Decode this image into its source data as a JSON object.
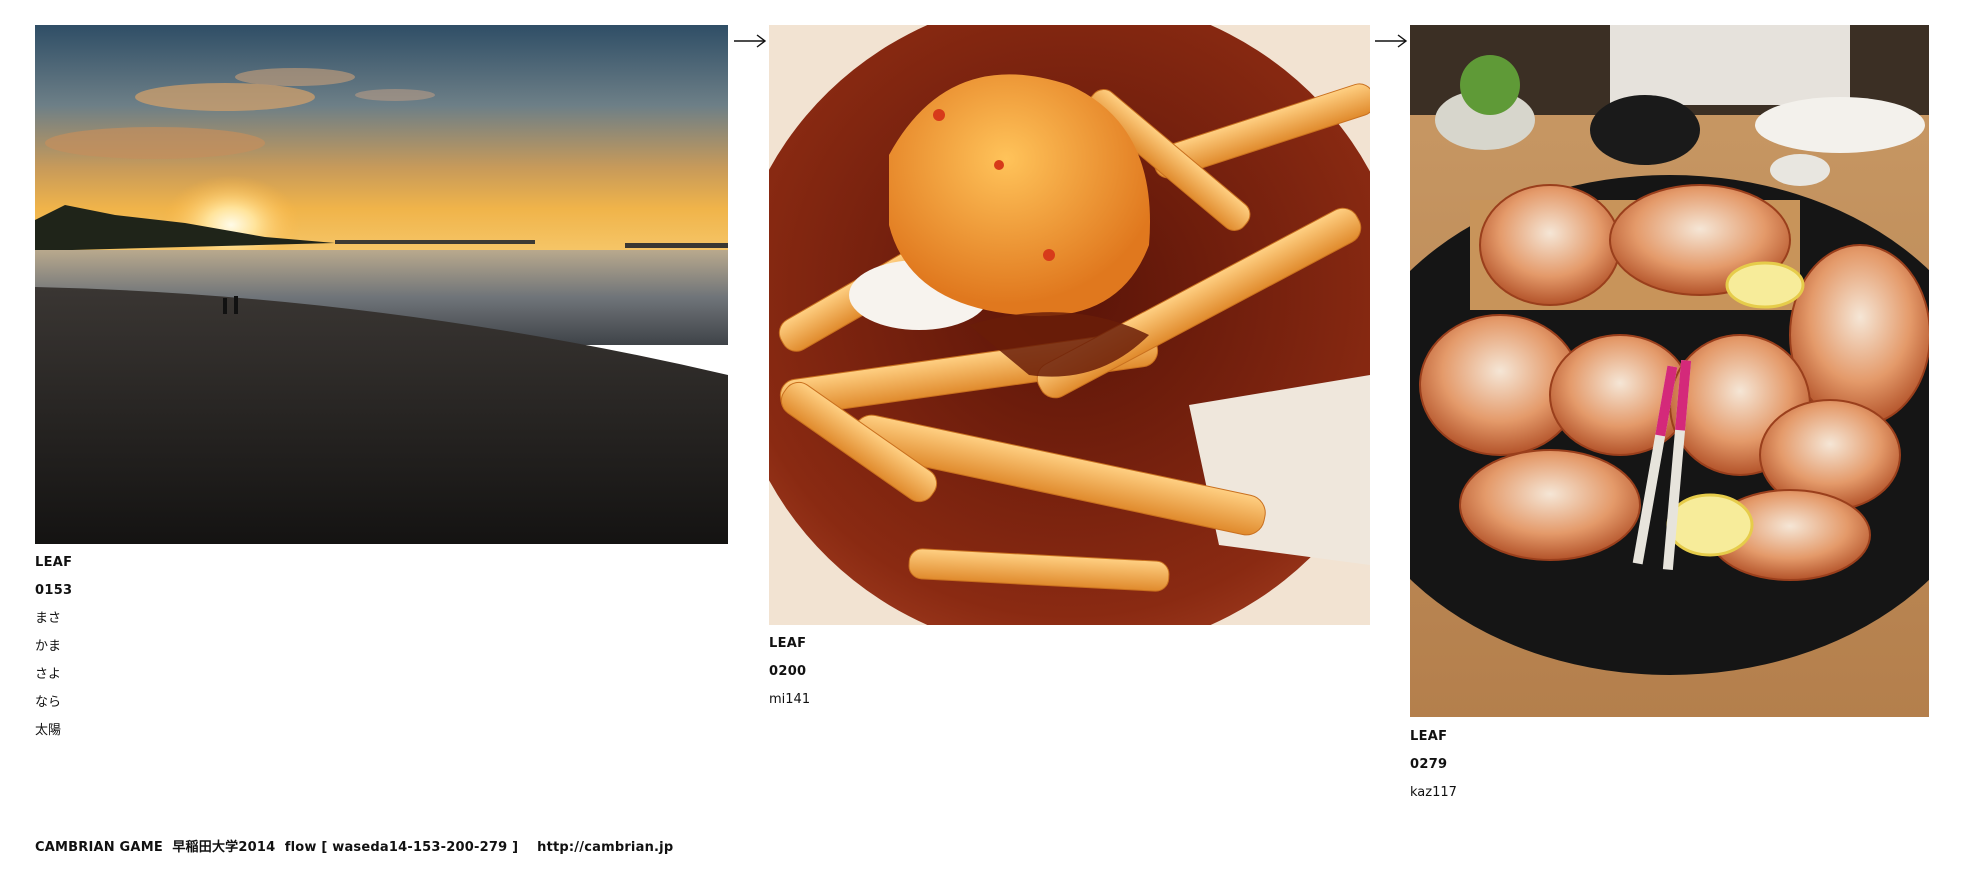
{
  "leaves": [
    {
      "code": "LEAF 0153",
      "lines": [
        "まさかま",
        "さよなら太陽"
      ],
      "image": "sunset-beach-photo"
    },
    {
      "code": "LEAF 0200",
      "lines": [
        "mi141"
      ],
      "image": "fries-bowl-photo"
    },
    {
      "code": "LEAF 0279",
      "lines": [
        "kaz117"
      ],
      "image": "crab-platter-photo"
    }
  ],
  "footer": {
    "text": "CAMBRIAN GAME  早稲田大学2014  flow [ waseda14-153-200-279 ]    http://cambrian.jp"
  },
  "icons": {
    "arrow": "right-arrow-icon"
  },
  "colors": {
    "background": "#ffffff",
    "text": "#111111"
  }
}
